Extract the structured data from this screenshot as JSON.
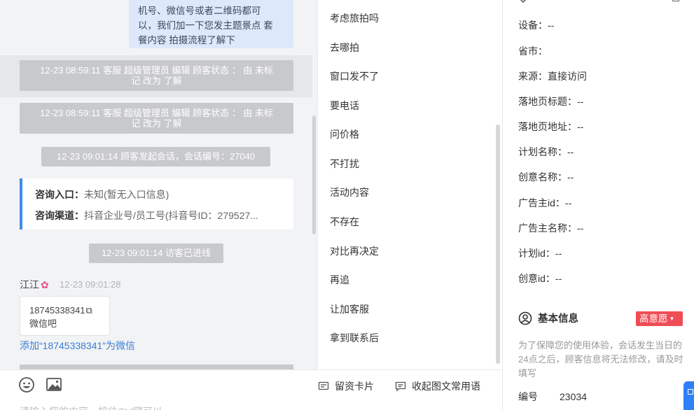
{
  "chat": {
    "self_message_lines": [
      "机号、微信号或者二维码都可",
      "以，我们加一下您发主题景点 套",
      "餐内容 拍摄流程了解下"
    ],
    "system_events": [
      {
        "line1": "12-23 08:59:11 客服 超级管理员 编辑 顾客状态 ： 由 未标",
        "line2": "记 改为 了解"
      },
      {
        "line1": "12-23 08:59:11 客服 超级管理员 编辑 顾客状态 ： 由 未标",
        "line2": "记 改为 了解"
      },
      {
        "text": "12-23 09:01:14 顾客发起会话，会话编号：27040"
      },
      {
        "text": "12-23 09:01:14 访客已进线"
      }
    ],
    "consult": {
      "entry_label": "咨询入口：",
      "entry_value": "未知(暂无入口信息)",
      "channel_label": "咨询渠道：",
      "channel_value": "抖音企业号/员工号(抖音号ID：279527..."
    },
    "sender_name": "江江",
    "sender_icon": "flower-icon",
    "sender_time": "12-23 09:01:28",
    "customer_message": {
      "phone": "18745338341",
      "text": "微信吧"
    },
    "add_wechat_link": "添加“18745338341”为微信"
  },
  "toolbar": {
    "emoji_icon": "emoji-icon",
    "image_icon": "image-icon",
    "card_label": "留资卡片",
    "phrase_label": "收起图文常用语",
    "input_text": "请输入您的内容，按住Ctrl键可以…"
  },
  "quick_replies": [
    "考虑旅拍吗",
    "去哪拍",
    "窗口发不了",
    "要电话",
    "问价格",
    "不打扰",
    "活动内容",
    "不存在",
    "对比再决定",
    "再追",
    "让加客服",
    "拿到联系后"
  ],
  "info": {
    "fields": [
      {
        "label": "设备：",
        "value": "--"
      },
      {
        "label": "省市：",
        "value": ""
      },
      {
        "label": "来源：",
        "value": "直接访问"
      },
      {
        "label": "落地页标题：",
        "value": "--"
      },
      {
        "label": "落地页地址：",
        "value": "--"
      },
      {
        "label": "计划名称：",
        "value": "--"
      },
      {
        "label": "创意名称：",
        "value": "--"
      },
      {
        "label": "广告主id：",
        "value": "--"
      },
      {
        "label": "广告主名称：",
        "value": "--"
      },
      {
        "label": "计划id：",
        "value": "--"
      },
      {
        "label": "创意id：",
        "value": "--"
      }
    ],
    "section_title": "基本信息",
    "section_icon": "user-circle-icon",
    "intent_badge": "高意愿",
    "intent_color": "#ef4d55",
    "notice": "为了保障您的使用体验，会话发生当日的24点之后，顾客信息将无法修改，请及时填写",
    "id_label": "编号",
    "id_value": "23034"
  },
  "colors": {
    "accent": "#3b8bf0",
    "link": "#3a7fd6",
    "self_bubble": "#dde8fb",
    "system_pill": "#c8c9cc"
  }
}
